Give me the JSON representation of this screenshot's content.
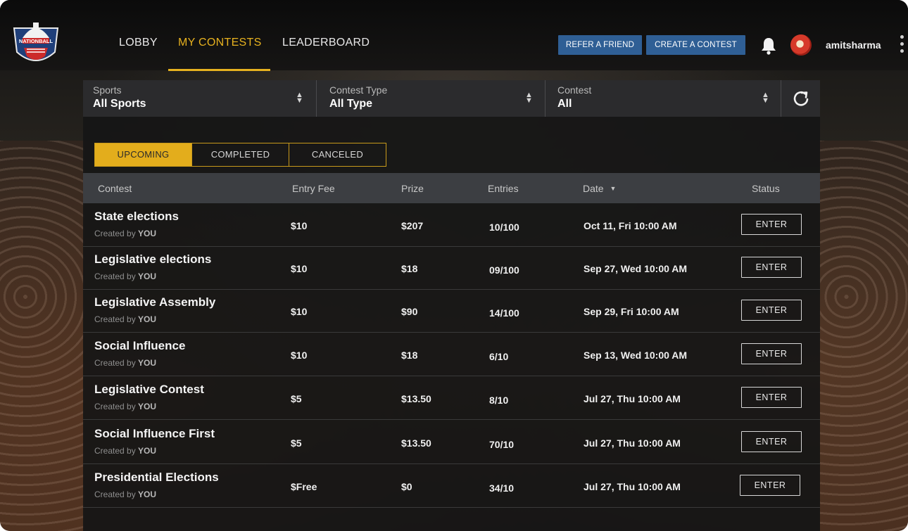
{
  "brand": {
    "logo_text": "NATIONBALL"
  },
  "nav": {
    "items": [
      {
        "label": "LOBBY"
      },
      {
        "label": "MY CONTESTS",
        "active": true
      },
      {
        "label": "LEADERBOARD"
      }
    ]
  },
  "header": {
    "refer_label": "REFER A FRIEND",
    "create_label": "CREATE A CONTEST",
    "username": "amitsharma"
  },
  "filters": [
    {
      "label": "Sports",
      "value": "All Sports"
    },
    {
      "label": "Contest Type",
      "value": "All Type"
    },
    {
      "label": "Contest",
      "value": "All"
    }
  ],
  "tabs": [
    {
      "label": "UPCOMING",
      "active": true
    },
    {
      "label": "COMPLETED"
    },
    {
      "label": "CANCELED"
    }
  ],
  "table": {
    "columns": [
      "Contest",
      "Entry Fee",
      "Prize",
      "Entries",
      "Date",
      "Status"
    ],
    "sort_indicator": "▼",
    "created_prefix": "Created by",
    "created_by": "YOU",
    "rows": [
      {
        "name": "State elections",
        "fee": "$10",
        "prize": "$207",
        "entries": "10/100",
        "date": "Oct 11, Fri 10:00 AM",
        "action": "ENTER"
      },
      {
        "name": "Legislative elections",
        "fee": "$10",
        "prize": "$18",
        "entries": "09/100",
        "date": "Sep 27, Wed 10:00 AM",
        "action": "ENTER"
      },
      {
        "name": "Legislative Assembly",
        "fee": "$10",
        "prize": "$90",
        "entries": "14/100",
        "date": "Sep 29, Fri 10:00 AM",
        "action": "ENTER"
      },
      {
        "name": "Social Influence",
        "fee": "$10",
        "prize": "$18",
        "entries": "6/10",
        "date": "Sep 13, Wed 10:00 AM",
        "action": "ENTER"
      },
      {
        "name": "Legislative Contest",
        "fee": "$5",
        "prize": "$13.50",
        "entries": "8/10",
        "date": "Jul 27, Thu 10:00 AM",
        "action": "ENTER"
      },
      {
        "name": "Social Influence First",
        "fee": "$5",
        "prize": "$13.50",
        "entries": "70/10",
        "date": "Jul 27, Thu 10:00 AM",
        "action": "ENTER"
      },
      {
        "name": "Presidential Elections",
        "fee": "$Free",
        "prize": "$0",
        "entries": "34/10",
        "date": "Jul 27, Thu 10:00 AM",
        "action": "ENTER"
      }
    ]
  },
  "colors": {
    "accent": "#e3ad1c",
    "button_blue": "#2f5f95",
    "header_row": "#3c3e42",
    "panel": "#161616"
  },
  "icons": [
    "bell-icon",
    "refresh-icon",
    "kebab-menu-icon",
    "sort-down-icon",
    "select-arrows-icon"
  ]
}
